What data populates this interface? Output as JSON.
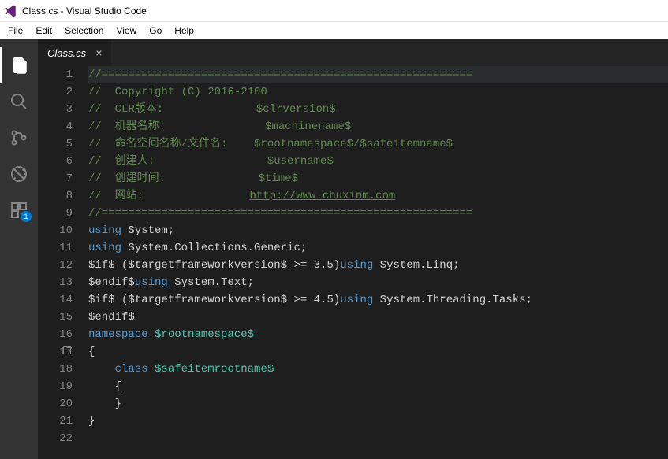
{
  "titlebar": {
    "text": "Class.cs - Visual Studio Code"
  },
  "menubar": {
    "items": [
      "File",
      "Edit",
      "Selection",
      "View",
      "Go",
      "Help"
    ]
  },
  "activitybar": {
    "scm_badge": "1"
  },
  "tabs": {
    "active": {
      "label": "Class.cs",
      "close": "×"
    }
  },
  "code": {
    "lines": [
      {
        "n": "1",
        "segs": [
          {
            "c": "c-comment",
            "t": "//========================================================"
          }
        ]
      },
      {
        "n": "2",
        "segs": [
          {
            "c": "c-comment",
            "t": "//  Copyright (C) 2016-2100"
          }
        ]
      },
      {
        "n": "3",
        "segs": [
          {
            "c": "c-comment",
            "t": "//  CLR版本:              $clrversion$"
          }
        ]
      },
      {
        "n": "4",
        "segs": [
          {
            "c": "c-comment",
            "t": "//  机器名称:               $machinename$"
          }
        ]
      },
      {
        "n": "5",
        "segs": [
          {
            "c": "c-comment",
            "t": "//  命名空间名称/文件名:    $rootnamespace$/$safeitemname$"
          }
        ]
      },
      {
        "n": "6",
        "segs": [
          {
            "c": "c-comment",
            "t": "//  创建人:                 $username$"
          }
        ]
      },
      {
        "n": "7",
        "segs": [
          {
            "c": "c-comment",
            "t": "//  创建时间:              $time$"
          }
        ]
      },
      {
        "n": "8",
        "segs": [
          {
            "c": "c-comment",
            "t": "//  网站:                "
          },
          {
            "c": "c-link",
            "t": "http://www.chuxinm.com"
          }
        ]
      },
      {
        "n": "9",
        "segs": [
          {
            "c": "c-comment",
            "t": "//========================================================"
          }
        ]
      },
      {
        "n": "10",
        "segs": [
          {
            "c": "c-keyword",
            "t": "using"
          },
          {
            "c": "c-plain",
            "t": " System;"
          }
        ]
      },
      {
        "n": "11",
        "segs": [
          {
            "c": "c-keyword",
            "t": "using"
          },
          {
            "c": "c-plain",
            "t": " System.Collections.Generic;"
          }
        ]
      },
      {
        "n": "12",
        "segs": [
          {
            "c": "c-plain",
            "t": "$if$ ($targetframeworkversion$ >= 3.5)"
          },
          {
            "c": "c-keyword",
            "t": "using"
          },
          {
            "c": "c-plain",
            "t": " System.Linq;"
          }
        ]
      },
      {
        "n": "13",
        "segs": [
          {
            "c": "c-plain",
            "t": "$endif$"
          },
          {
            "c": "c-keyword",
            "t": "using"
          },
          {
            "c": "c-plain",
            "t": " System.Text;"
          }
        ]
      },
      {
        "n": "14",
        "segs": [
          {
            "c": "c-plain",
            "t": "$if$ ($targetframeworkversion$ >= 4.5)"
          },
          {
            "c": "c-keyword",
            "t": "using"
          },
          {
            "c": "c-plain",
            "t": " System.Threading.Tasks;"
          }
        ]
      },
      {
        "n": "15",
        "segs": [
          {
            "c": "c-plain",
            "t": "$endif$"
          }
        ]
      },
      {
        "n": "16",
        "segs": [
          {
            "c": "c-keyword",
            "t": "namespace"
          },
          {
            "c": "c-plain",
            "t": " "
          },
          {
            "c": "c-type",
            "t": "$rootnamespace$"
          }
        ]
      },
      {
        "n": "17",
        "fold": true,
        "segs": [
          {
            "c": "c-plain",
            "t": "{"
          }
        ]
      },
      {
        "n": "18",
        "segs": [
          {
            "c": "c-plain",
            "t": "    "
          },
          {
            "c": "c-keyword",
            "t": "class"
          },
          {
            "c": "c-plain",
            "t": " "
          },
          {
            "c": "c-type",
            "t": "$safeitemrootname$"
          }
        ]
      },
      {
        "n": "19",
        "segs": [
          {
            "c": "c-plain",
            "t": "    {"
          }
        ]
      },
      {
        "n": "20",
        "segs": [
          {
            "c": "c-plain",
            "t": "    }"
          }
        ]
      },
      {
        "n": "21",
        "segs": [
          {
            "c": "c-plain",
            "t": "}"
          }
        ]
      },
      {
        "n": "22",
        "segs": []
      }
    ]
  }
}
